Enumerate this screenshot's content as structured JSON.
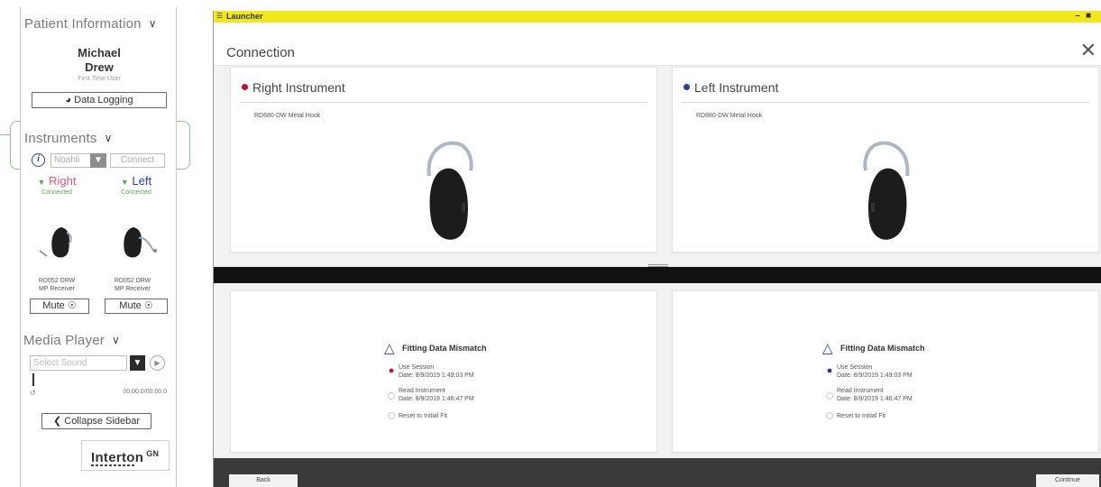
{
  "sidebar": {
    "patient_header": "Patient Information",
    "chevron": "∨",
    "first_name": "Michael",
    "last_name": "Drew",
    "user_type": "First Time User",
    "data_logging": "Data Logging",
    "instruments_header": "Instruments",
    "info": "i",
    "noahlink": "Noahli",
    "connect": "Connect",
    "right_label": "Right",
    "right_status": "Connected",
    "left_label": "Left",
    "left_status": "Connected",
    "right_model_line1": "RD052 DRW",
    "right_model_line2": "MP Receiver",
    "left_model_line1": "RD052 DRW",
    "left_model_line2": "MP Receiver",
    "mute_right": "Mute",
    "mute_left": "Mute",
    "media_header": "Media Player",
    "select_sound_placeholder": "Select Sound",
    "time": "00:00.0/00:00.0",
    "collapse": "Collapse Sidebar",
    "logo": "Interton",
    "logo_sup": "GN"
  },
  "window": {
    "title": "Launcher",
    "header": "Connection",
    "right": {
      "title": "Right Instrument",
      "model": "RD680-DW  Metal Hook",
      "mismatch": "Fitting Data Mismatch",
      "use_session": "Use Session",
      "use_session_date": "Date: 8/9/2019 1:49:03 PM",
      "read_instrument": "Read Instrument",
      "read_instrument_date": "Date: 8/9/2019 1:46:47 PM",
      "reset": "Reset to Initial Fit"
    },
    "left": {
      "title": "Left Instrument",
      "model": "RD680-DW  Metal Hook",
      "mismatch": "Fitting Data Mismatch",
      "use_session": "Use Session",
      "use_session_date": "Date: 8/9/2019 1:49:03 PM",
      "read_instrument": "Read Instrument",
      "read_instrument_date": "Date: 8/9/2019 1:46:47 PM",
      "reset": "Reset to Initial Fit"
    },
    "back": "Back",
    "continue": "Continue"
  },
  "colors": {
    "accent_yellow": "#f1e71a",
    "right_red": "#c0103a",
    "left_blue": "#2a3c9c",
    "connected_green": "#5aa85a",
    "highlight_green": "#8cc68c"
  }
}
